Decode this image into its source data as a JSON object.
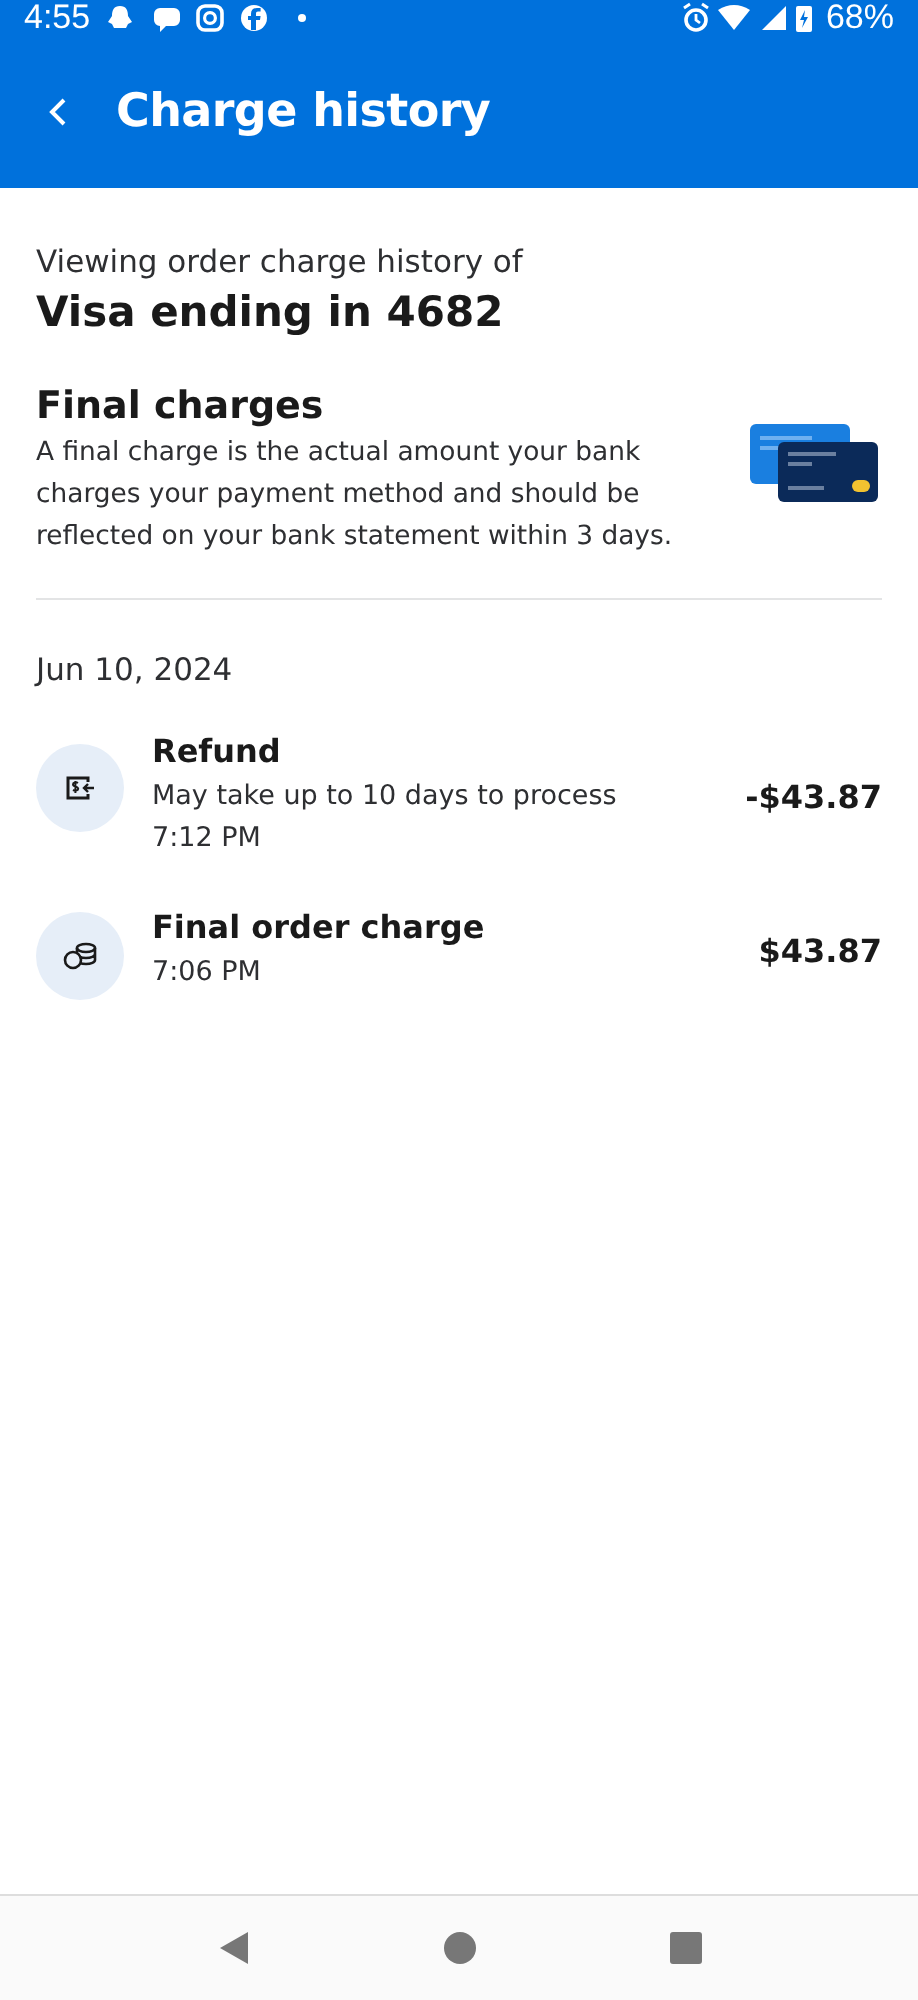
{
  "status_bar": {
    "time": "4:55",
    "battery": "68%"
  },
  "header": {
    "title": "Charge history"
  },
  "intro": {
    "caption": "Viewing order charge history of",
    "card": "Visa ending in 4682"
  },
  "final_charges": {
    "title": "Final charges",
    "description": "A final charge is the actual amount your bank charges your payment method and should be reflected on your bank statement within 3 days."
  },
  "date": "Jun 10, 2024",
  "transactions": [
    {
      "kind": "refund",
      "title": "Refund",
      "note": "May take up to 10 days to process",
      "time": "7:12 PM",
      "amount": "-$43.87"
    },
    {
      "kind": "charge",
      "title": "Final order charge",
      "time": "7:06 PM",
      "amount": "$43.87"
    }
  ]
}
